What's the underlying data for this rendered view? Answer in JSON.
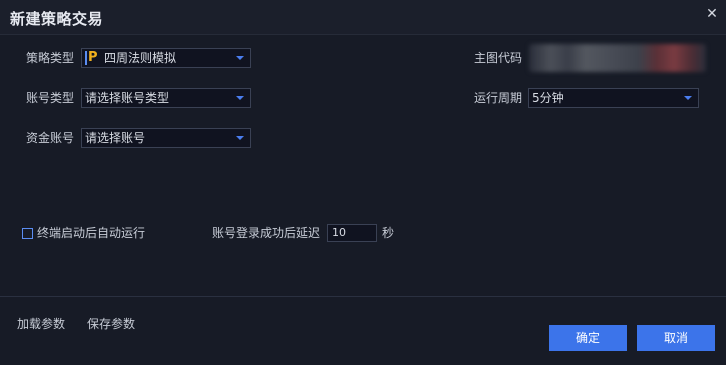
{
  "dialog": {
    "title": "新建策略交易",
    "close_icon": "close-icon"
  },
  "form": {
    "strategy_type_label": "策略类型",
    "strategy_type_badge": "P",
    "strategy_type_value": "四周法则模拟",
    "account_type_label": "账号类型",
    "account_type_value": "请选择账号类型",
    "fund_account_label": "资金账号",
    "fund_account_value": "请选择账号",
    "main_code_label": "主图代码",
    "run_period_label": "运行周期",
    "run_period_value": "5分钟"
  },
  "options": {
    "auto_run_label": "终端启动后自动运行",
    "auto_run_checked": false,
    "delay_label": "账号登录成功后延迟",
    "delay_value": "10",
    "delay_unit": "秒"
  },
  "footer": {
    "load_params": "加载参数",
    "save_params": "保存参数",
    "ok": "确定",
    "cancel": "取消"
  },
  "colors": {
    "background": "#171b26",
    "accent": "#3c74ea",
    "badge": "#f0b01e"
  }
}
